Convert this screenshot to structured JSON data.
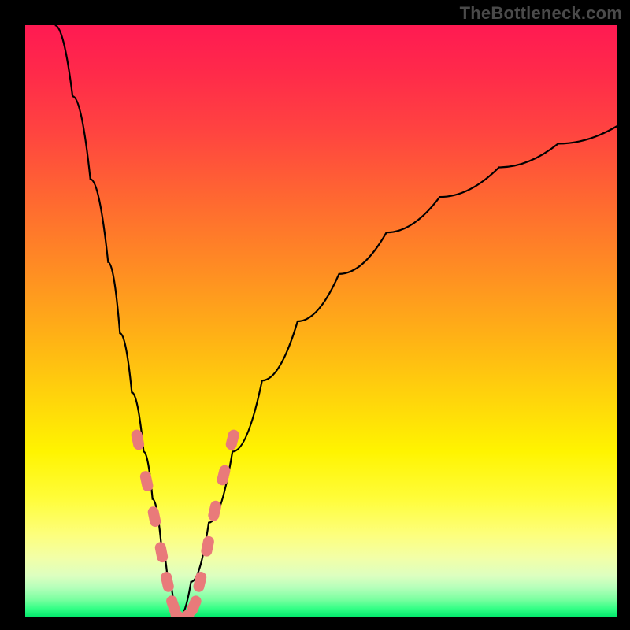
{
  "watermark": "TheBottleneck.com",
  "colors": {
    "background": "#000000",
    "curve_stroke": "#000000",
    "marker_fill": "#e97a7a",
    "watermark_text": "#4a4a4a"
  },
  "chart_data": {
    "type": "line",
    "title": "",
    "xlabel": "",
    "ylabel": "",
    "xlim": [
      0,
      100
    ],
    "ylim": [
      0,
      100
    ],
    "grid": false,
    "gradient_description": "vertical red→yellow→green background, green at bottom",
    "series": [
      {
        "name": "left-branch",
        "comment": "steep descending curve from top-left toward minimum",
        "x": [
          5,
          8,
          11,
          14,
          16,
          18,
          20,
          21.5,
          23,
          24,
          25,
          26
        ],
        "y": [
          100,
          88,
          74,
          60,
          48,
          38,
          28,
          20,
          12,
          7,
          3,
          0
        ]
      },
      {
        "name": "right-branch",
        "comment": "rising curve from minimum toward upper-right, flattening",
        "x": [
          26,
          28,
          31,
          35,
          40,
          46,
          53,
          61,
          70,
          80,
          90,
          100
        ],
        "y": [
          0,
          6,
          16,
          28,
          40,
          50,
          58,
          65,
          71,
          76,
          80,
          83
        ]
      }
    ],
    "markers": {
      "name": "highlighted-points",
      "shape": "rounded-pill",
      "color": "#e97a7a",
      "points": [
        {
          "x": 19.0,
          "y": 30
        },
        {
          "x": 20.5,
          "y": 23
        },
        {
          "x": 21.8,
          "y": 17
        },
        {
          "x": 23.0,
          "y": 11
        },
        {
          "x": 24.0,
          "y": 6
        },
        {
          "x": 25.0,
          "y": 2
        },
        {
          "x": 26.0,
          "y": 0
        },
        {
          "x": 27.0,
          "y": 0
        },
        {
          "x": 28.5,
          "y": 2
        },
        {
          "x": 29.5,
          "y": 6
        },
        {
          "x": 30.8,
          "y": 12
        },
        {
          "x": 32.0,
          "y": 18
        },
        {
          "x": 33.5,
          "y": 24
        },
        {
          "x": 35.0,
          "y": 30
        }
      ]
    },
    "minimum": {
      "x": 26.5,
      "y": 0
    }
  }
}
